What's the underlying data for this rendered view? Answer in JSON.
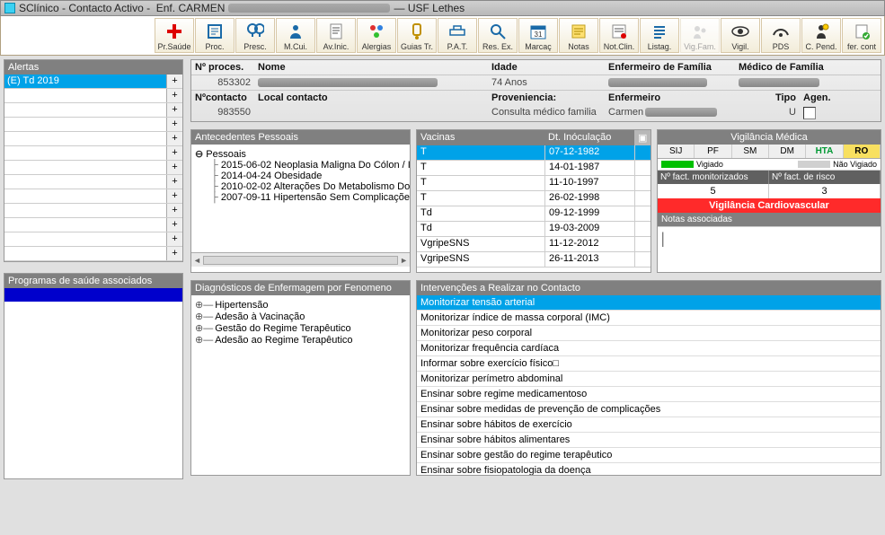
{
  "title": {
    "app": "SClínico",
    "section": "Contacto Activo",
    "nurse_prefix": "Enf.",
    "nurse": "CARMEN",
    "unit": "USF Lethes"
  },
  "toolbar": [
    {
      "id": "pr-saude",
      "label": "Pr.Saúde",
      "enabled": true
    },
    {
      "id": "proc",
      "label": "Proc.",
      "enabled": true
    },
    {
      "id": "presc",
      "label": "Presc.",
      "enabled": true
    },
    {
      "id": "m-cui",
      "label": "M.Cui.",
      "enabled": true
    },
    {
      "id": "av-inic",
      "label": "Av.Inic.",
      "enabled": true
    },
    {
      "id": "alergias",
      "label": "Alergias",
      "enabled": true
    },
    {
      "id": "guias-tr",
      "label": "Guias Tr.",
      "enabled": true
    },
    {
      "id": "pat",
      "label": "P.A.T.",
      "enabled": true
    },
    {
      "id": "res-ex",
      "label": "Res. Ex.",
      "enabled": true
    },
    {
      "id": "marcac",
      "label": "Marcaç",
      "enabled": true
    },
    {
      "id": "notas",
      "label": "Notas",
      "enabled": true
    },
    {
      "id": "not-clin",
      "label": "Not.Clin.",
      "enabled": true
    },
    {
      "id": "listag",
      "label": "Listag.",
      "enabled": true
    },
    {
      "id": "vig-fam",
      "label": "Vig.Fam.",
      "enabled": false
    },
    {
      "id": "vigil",
      "label": "Vigil.",
      "enabled": true
    },
    {
      "id": "pds",
      "label": "PDS",
      "enabled": true
    },
    {
      "id": "c-pend",
      "label": "C. Pend.",
      "enabled": true
    },
    {
      "id": "fer-cont",
      "label": "fer. cont",
      "enabled": true
    }
  ],
  "alerts": {
    "header": "Alertas",
    "items": [
      "(E) Td 2019",
      "",
      "",
      "",
      "",
      "",
      "",
      "",
      "",
      "",
      "",
      "",
      ""
    ]
  },
  "programs": {
    "header": "Programas de saúde associados"
  },
  "patient": {
    "labels": {
      "proc": "Nº proces.",
      "nome": "Nome",
      "idade": "Idade",
      "enf_fam": "Enfermeiro de Família",
      "med_fam": "Médico de Família",
      "contacto": "Nºcontacto",
      "local": "Local contacto",
      "prov": "Proveniencia:",
      "enf": "Enfermeiro",
      "tipo": "Tipo",
      "agen": "Agen."
    },
    "values": {
      "proc": "853302",
      "idade": "74 Anos",
      "contacto": "983550",
      "prov": "Consulta médico familia",
      "enf": "Carmen",
      "tipo": "U"
    }
  },
  "antecedentes": {
    "header": "Antecedentes Pessoais",
    "root": "Pessoais",
    "items": [
      "2015-06-02 Neoplasia Maligna Do Cólon / I",
      "2014-04-24 Obesidade",
      "2010-02-02 Alterações Do Metabolismo Do",
      "2007-09-11 Hipertensão Sem Complicaçõe"
    ]
  },
  "vacinas": {
    "header_vac": "Vacinas",
    "header_dt": "Dt. Inóculação",
    "rows": [
      {
        "v": "T",
        "d": "07-12-1982",
        "sel": true
      },
      {
        "v": "T",
        "d": "14-01-1987"
      },
      {
        "v": "T",
        "d": "11-10-1997"
      },
      {
        "v": "T",
        "d": "26-02-1998"
      },
      {
        "v": "Td",
        "d": "09-12-1999"
      },
      {
        "v": "Td",
        "d": "19-03-2009"
      },
      {
        "v": "VgripeSNS",
        "d": "11-12-2012"
      },
      {
        "v": "VgripeSNS",
        "d": "26-11-2013"
      }
    ]
  },
  "vigilancia": {
    "header": "Vigilância Médica",
    "tabs": [
      "SIJ",
      "PF",
      "SM",
      "DM",
      "HTA",
      "RO"
    ],
    "legend": {
      "on": "Vigiado",
      "off": "Não Vigiado"
    },
    "counts": {
      "mon_label": "Nº fact. monitorizados",
      "mon_val": "5",
      "risk_label": "Nº fact. de risco",
      "risk_val": "3"
    },
    "alert": "Vigilância Cardiovascular",
    "notas_header": "Notas associadas",
    "notas_val": "|"
  },
  "diagnosticos": {
    "header": "Diagnósticos de Enfermagem por Fenomeno",
    "items": [
      "Hipertensão",
      "Adesão à Vacinação",
      "Gestão do Regime Terapêutico",
      "Adesão ao Regime Terapêutico"
    ]
  },
  "intervencoes": {
    "header": "Intervenções a Realizar no Contacto",
    "items": [
      "Monitorizar tensão arterial",
      "Monitorizar índice de massa corporal (IMC)",
      "Monitorizar peso corporal",
      "Monitorizar frequência cardíaca",
      "Informar sobre exercício físico□",
      "Monitorizar perímetro abdominal",
      "Ensinar sobre regime medicamentoso",
      "Ensinar sobre medidas de prevenção de complicações",
      "Ensinar sobre hábitos de exercício",
      "Ensinar sobre hábitos  alimentares",
      "Ensinar sobre gestão do regime terapêutico",
      "Ensinar sobre fisiopatologia da doença"
    ]
  }
}
